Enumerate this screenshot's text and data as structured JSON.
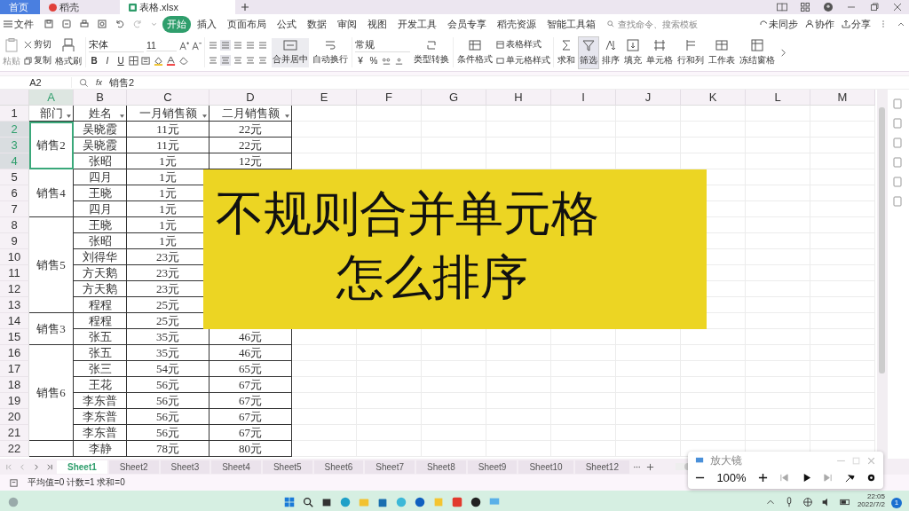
{
  "doc_tabs": [
    {
      "label": "首页",
      "selected": false,
      "kind": "home"
    },
    {
      "label": "稻壳",
      "selected": false,
      "kind": "docer"
    },
    {
      "label": "表格.xlsx",
      "selected": true,
      "kind": "sheet"
    }
  ],
  "menu": {
    "file": "文件",
    "ribbon_tabs": [
      {
        "label": "开始",
        "selected": true
      },
      {
        "label": "插入",
        "selected": false
      },
      {
        "label": "页面布局",
        "selected": false
      },
      {
        "label": "公式",
        "selected": false
      },
      {
        "label": "数据",
        "selected": false
      },
      {
        "label": "审阅",
        "selected": false
      },
      {
        "label": "视图",
        "selected": false
      },
      {
        "label": "开发工具",
        "selected": false
      },
      {
        "label": "会员专享",
        "selected": false
      },
      {
        "label": "稻壳资源",
        "selected": false
      },
      {
        "label": "智能工具箱",
        "selected": false
      }
    ],
    "search": {
      "placeholder": "查找命令、搜索模板"
    },
    "sync": "未同步",
    "collab": "协作",
    "share": "分享"
  },
  "ribbon": {
    "paste": "粘贴",
    "cut": "剪切",
    "copy": "复制",
    "painter": "格式刷",
    "font": "宋体",
    "size": "11",
    "format_buttons": [
      "B",
      "I",
      "U"
    ],
    "merge": "合并居中",
    "wrap": "自动换行",
    "number_format": "常规",
    "currency": "¥",
    "percent": "%",
    "convert": "类型转换",
    "conditional": "条件格式",
    "table_style": "表格样式",
    "cell_style": "单元格样式",
    "tools": [
      {
        "label": "求和",
        "selected": false
      },
      {
        "label": "筛选",
        "selected": true
      },
      {
        "label": "排序",
        "selected": false
      },
      {
        "label": "填充",
        "selected": false
      },
      {
        "label": "单元格",
        "selected": false
      },
      {
        "label": "行和列",
        "selected": false
      },
      {
        "label": "工作表",
        "selected": false
      },
      {
        "label": "冻结窗格",
        "selected": false
      }
    ]
  },
  "formula_bar": {
    "cell": "A2",
    "fx": "fx",
    "value": "销售2"
  },
  "sheet": {
    "columns": [
      {
        "label": "A",
        "selected": true
      },
      {
        "label": "B",
        "selected": false
      },
      {
        "label": "C",
        "selected": false
      },
      {
        "label": "D",
        "selected": false
      },
      {
        "label": "E",
        "selected": false
      },
      {
        "label": "F",
        "selected": false
      },
      {
        "label": "G",
        "selected": false
      },
      {
        "label": "H",
        "selected": false
      },
      {
        "label": "I",
        "selected": false
      },
      {
        "label": "J",
        "selected": false
      },
      {
        "label": "K",
        "selected": false
      },
      {
        "label": "L",
        "selected": false
      },
      {
        "label": "M",
        "selected": false
      }
    ],
    "header_row": {
      "number": "1",
      "cells": [
        "部门",
        "姓名",
        "一月销售额",
        "二月销售额"
      ]
    },
    "groups": [
      {
        "dept": "销售2",
        "selected": true,
        "rows": [
          {
            "number": "2",
            "name": "吴晓霞",
            "jan": "11元",
            "feb": "22元",
            "selected": true
          },
          {
            "number": "3",
            "name": "吴晓霞",
            "jan": "11元",
            "feb": "22元",
            "selected": true
          },
          {
            "number": "4",
            "name": "张昭",
            "jan": "1元",
            "feb": "12元",
            "selected": true
          }
        ]
      },
      {
        "dept": "销售4",
        "selected": false,
        "rows": [
          {
            "number": "5",
            "name": "四月",
            "jan": "1元",
            "selected": false
          },
          {
            "number": "6",
            "name": "王晓",
            "jan": "1元",
            "selected": false
          },
          {
            "number": "7",
            "name": "四月",
            "jan": "1元",
            "selected": false
          }
        ]
      },
      {
        "dept": "销售5",
        "selected": false,
        "rows": [
          {
            "number": "8",
            "name": "王晓",
            "jan": "1元",
            "selected": false
          },
          {
            "number": "9",
            "name": "张昭",
            "jan": "1元",
            "selected": false
          },
          {
            "number": "10",
            "name": "刘得华",
            "jan": "23元",
            "selected": false
          },
          {
            "number": "11",
            "name": "方天鹅",
            "jan": "23元",
            "selected": false
          },
          {
            "number": "12",
            "name": "方天鹅",
            "jan": "23元",
            "selected": false
          },
          {
            "number": "13",
            "name": "程程",
            "jan": "25元",
            "selected": false
          }
        ]
      },
      {
        "dept": "销售3",
        "selected": false,
        "rows": [
          {
            "number": "14",
            "name": "程程",
            "jan": "25元",
            "selected": false
          },
          {
            "number": "15",
            "name": "张五",
            "jan": "35元",
            "feb": "46元",
            "selected": false
          }
        ]
      },
      {
        "dept": "销售6",
        "selected": false,
        "rows": [
          {
            "number": "16",
            "name": "张五",
            "jan": "35元",
            "feb": "46元",
            "selected": false
          },
          {
            "number": "17",
            "name": "张三",
            "jan": "54元",
            "feb": "65元",
            "selected": false
          },
          {
            "number": "18",
            "name": "王花",
            "jan": "56元",
            "feb": "67元",
            "selected": false
          },
          {
            "number": "19",
            "name": "李东普",
            "jan": "56元",
            "feb": "67元",
            "selected": false
          },
          {
            "number": "20",
            "name": "李东普",
            "jan": "56元",
            "feb": "67元",
            "selected": false
          },
          {
            "number": "21",
            "name": "李东普",
            "jan": "56元",
            "feb": "67元",
            "selected": false
          }
        ]
      },
      {
        "selected": false,
        "rows": [
          {
            "number": "22",
            "name": "李静",
            "jan": "78元",
            "feb": "80元",
            "selected": false
          }
        ]
      }
    ]
  },
  "overlay": {
    "lines": [
      "不规则合并单元格",
      "怎么排序"
    ]
  },
  "sheet_tabs": [
    {
      "label": "Sheet1",
      "selected": true
    },
    {
      "label": "Sheet2",
      "selected": false
    },
    {
      "label": "Sheet3",
      "selected": false
    },
    {
      "label": "Sheet4",
      "selected": false
    },
    {
      "label": "Sheet5",
      "selected": false
    },
    {
      "label": "Sheet6",
      "selected": false
    },
    {
      "label": "Sheet7",
      "selected": false
    },
    {
      "label": "Sheet8",
      "selected": false
    },
    {
      "label": "Sheet9",
      "selected": false
    },
    {
      "label": "Sheet10",
      "selected": false
    },
    {
      "label": "Sheet12",
      "selected": false
    }
  ],
  "status_bar": {
    "stats": "平均值=0  计数=1  求和=0"
  },
  "magnifier": {
    "title": "放大镜",
    "zoom": "100%"
  },
  "taskbar": {
    "time": "22:05",
    "date": "2022/7/2",
    "notifications": "1"
  }
}
